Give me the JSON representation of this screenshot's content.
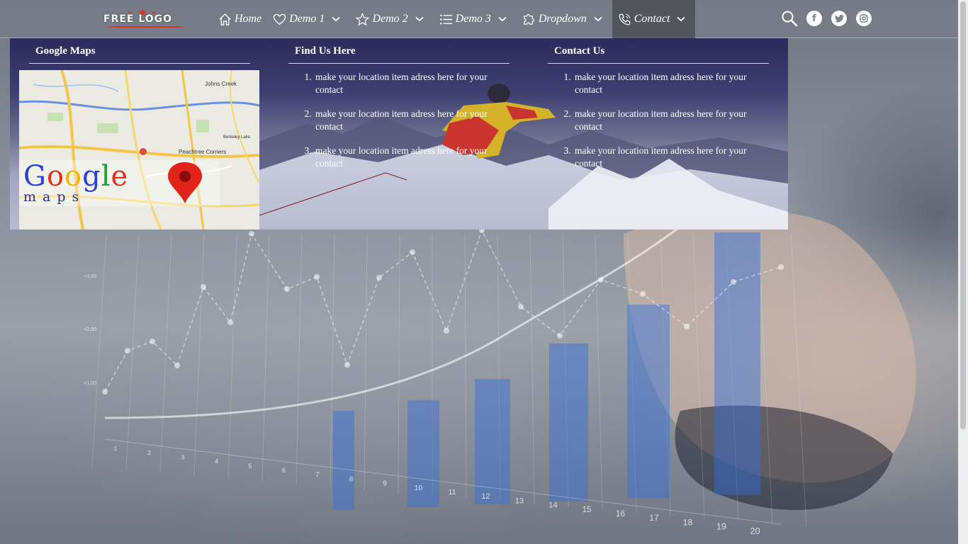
{
  "brand": {
    "logo_text": "FREE LOGO"
  },
  "nav": {
    "items": [
      {
        "label": "Home",
        "icon": "home-icon",
        "has_dropdown": false,
        "active": false
      },
      {
        "label": "Demo 1",
        "icon": "heart-icon",
        "has_dropdown": true,
        "active": false
      },
      {
        "label": "Demo 2",
        "icon": "star-icon",
        "has_dropdown": true,
        "active": false
      },
      {
        "label": "Demo 3",
        "icon": "list-icon",
        "has_dropdown": true,
        "active": false
      },
      {
        "label": "Dropdown",
        "icon": "puzzle-icon",
        "has_dropdown": true,
        "active": false
      },
      {
        "label": "Contact",
        "icon": "phone-icon",
        "has_dropdown": true,
        "active": true
      }
    ],
    "social": [
      "search-icon",
      "facebook-icon",
      "twitter-icon",
      "instagram-icon"
    ]
  },
  "mega_menu": {
    "google_maps": {
      "title": "Google Maps",
      "logo_word": "Google",
      "logo_sub": "maps",
      "map_labels": [
        "Johns Creek",
        "Peachtree Corners",
        "Berkeley Lake"
      ]
    },
    "find_us": {
      "title": "Find Us Here",
      "items": [
        "make your location item adress here for your contact",
        "make your location item adress here for your contact",
        "make your location item adress here for your contact"
      ]
    },
    "contact_us": {
      "title": "Contact Us",
      "items": [
        "make your location item adress here for your contact",
        "make your location item adress here for your contact",
        "make your location item adress here for your contact"
      ]
    }
  },
  "background_chart": {
    "y_ticks": [
      "+1,00",
      "+2,00",
      "+3,00"
    ],
    "x_ticks": [
      "1",
      "2",
      "3",
      "4",
      "5",
      "6",
      "7",
      "8",
      "9",
      "10",
      "11",
      "12",
      "13",
      "14",
      "15",
      "16",
      "17",
      "18",
      "19",
      "20"
    ]
  },
  "colors": {
    "navbar": "#787d87",
    "active_menu": "#46484e",
    "logo_red": "#d9312a",
    "mega_top": "#2c2a5a"
  }
}
